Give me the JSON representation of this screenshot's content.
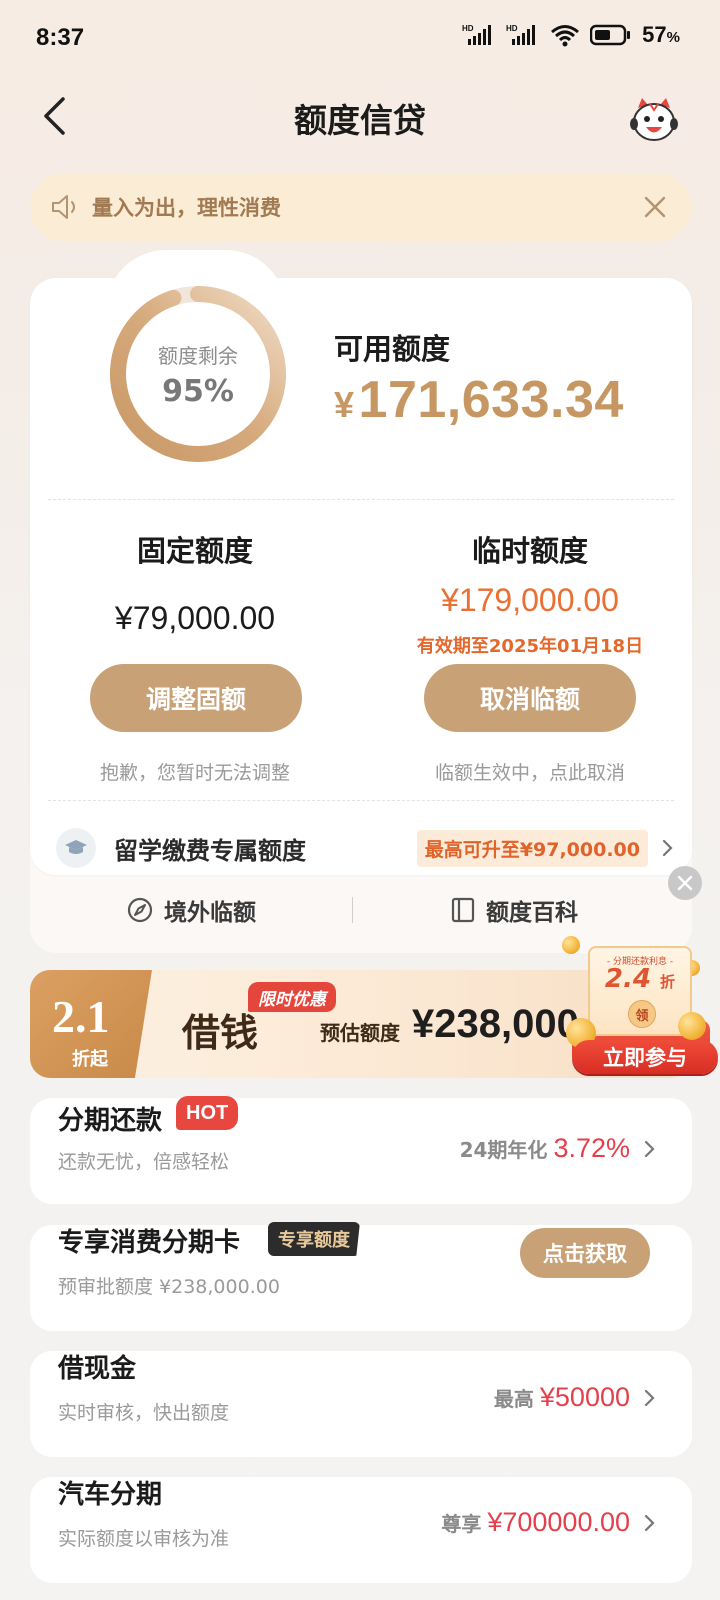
{
  "status_bar": {
    "time": "8:37",
    "battery_percent": "57",
    "battery_unit": "%"
  },
  "header": {
    "title": "额度信贷",
    "back_icon": "chevron-left-icon",
    "mascot_icon": "mascot-icon"
  },
  "notice": {
    "text": "量入为出，理性消费",
    "icon": "speaker-icon"
  },
  "quota": {
    "ring_label": "额度剩余",
    "ring_value": "95%",
    "remaining_fraction": 0.95,
    "available_label": "可用额度",
    "available_currency": "¥",
    "available_amount": "171,633.34"
  },
  "fixed": {
    "title": "固定额度",
    "amount": "¥79,000.00",
    "button": "调整固额",
    "note": "抱歉，您暂时无法调整"
  },
  "temporary": {
    "title": "临时额度",
    "amount": "¥179,000.00",
    "valid_until": "有效期至2025年01月18日",
    "button": "取消临额",
    "note": "临额生效中，点此取消"
  },
  "study": {
    "label": "留学缴费专属额度",
    "badge": "最高可升至¥97,000.00"
  },
  "tools": {
    "left": "境外临额",
    "right": "额度百科"
  },
  "promo": {
    "rate": "2.1",
    "rate_suffix": "折起",
    "title": "借钱",
    "tag": "限时优惠",
    "estimate_label": "预估额度",
    "estimate_amount": "¥238,000",
    "coupon_small": "- 分期还款利息 -",
    "coupon_rate": "2.4",
    "coupon_unit": "折",
    "coupon_claim": "领",
    "coupon_button": "立即参与"
  },
  "installment": {
    "title": "分期还款",
    "badge": "HOT",
    "subtitle": "还款无忧，倍感轻松",
    "right_label": "24期年化",
    "right_value": "3.72%"
  },
  "card": {
    "title": "专享消费分期卡",
    "badge": "专享额度",
    "subtitle": "预审批额度 ¥238,000.00",
    "button": "点击获取"
  },
  "cash": {
    "title": "借现金",
    "subtitle": "实时审核，快出额度",
    "right_label": "最高",
    "right_value": "¥50000"
  },
  "car": {
    "title": "汽车分期",
    "subtitle": "实际额度以审核为准",
    "right_label": "尊享",
    "right_value": "¥700000.00"
  },
  "colors": {
    "accent": "#c9a176",
    "orange": "#ea6f33",
    "red": "#e4404c"
  }
}
